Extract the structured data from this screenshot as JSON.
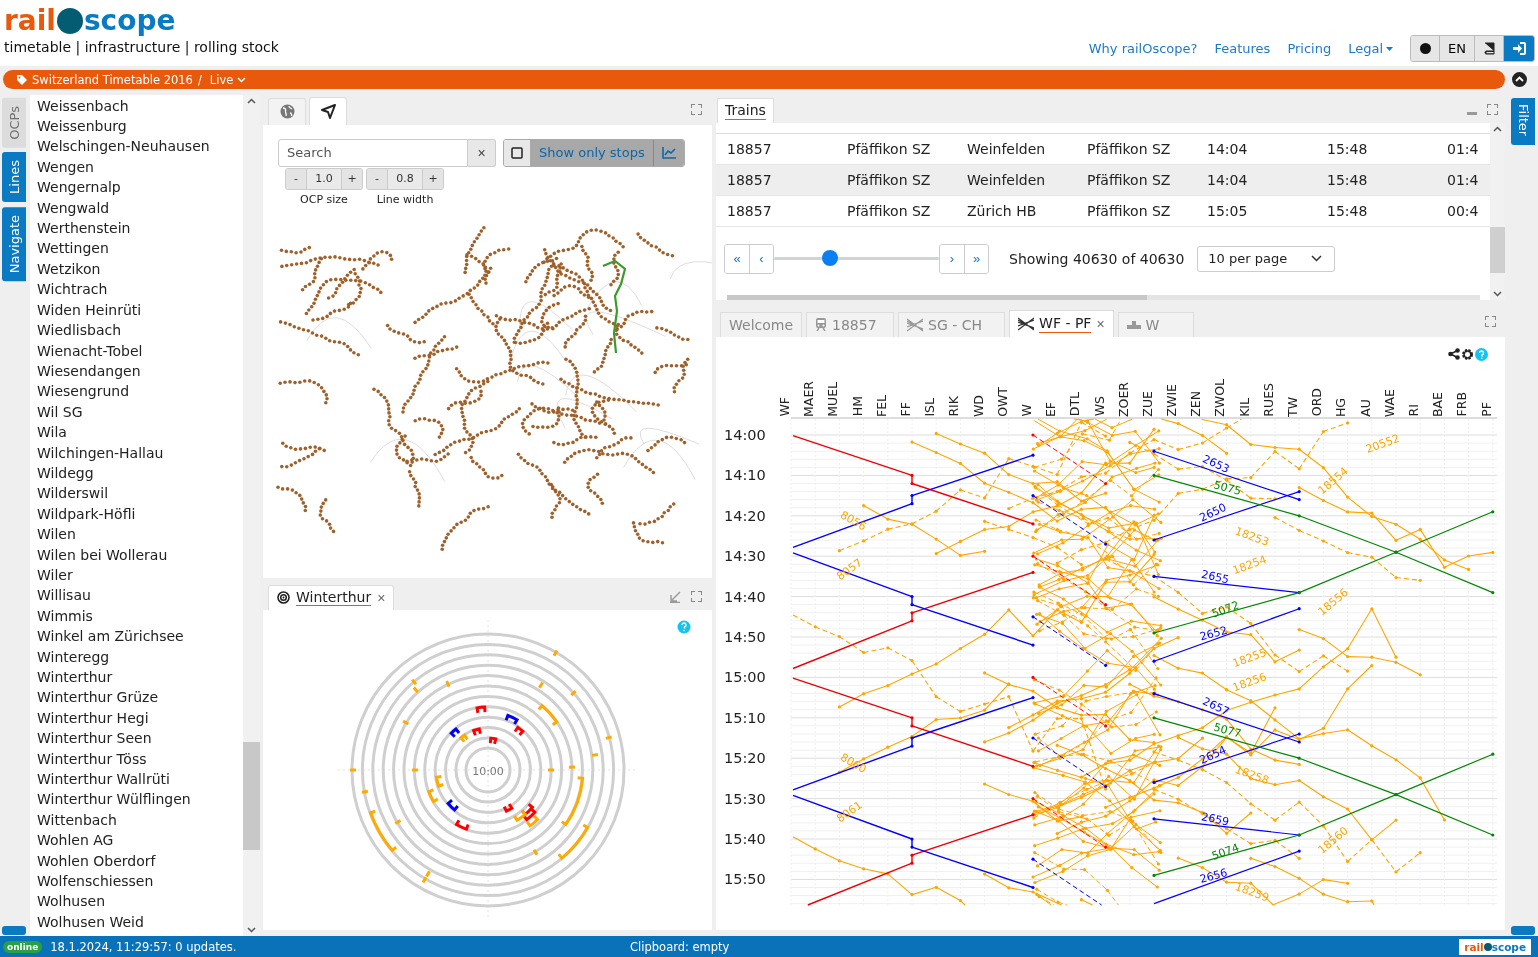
{
  "logo": {
    "part_1": "rail",
    "part_2": "scope"
  },
  "tagline": "timetable | infrastructure | rolling stock",
  "nav": [
    {
      "label": "Why railOscope?",
      "dropdown": false
    },
    {
      "label": "Features",
      "dropdown": false
    },
    {
      "label": "Pricing",
      "dropdown": false
    },
    {
      "label": "Legal",
      "dropdown": true
    }
  ],
  "toolbar": {
    "language": "EN"
  },
  "context_bar": {
    "timetable": "Switzerland Timetable 2016",
    "separator": "/",
    "mode": "Live"
  },
  "side_tabs": [
    {
      "label": "OCPs",
      "active": false
    },
    {
      "label": "Lines",
      "active": true
    },
    {
      "label": "Navigate",
      "active": true
    }
  ],
  "ocp_list": [
    "Weissenbach",
    "Weissenburg",
    "Welschingen-Neuhausen",
    "Wengen",
    "Wengernalp",
    "Wengwald",
    "Werthenstein",
    "Wettingen",
    "Wetzikon",
    "Wichtrach",
    "Widen Heinrüti",
    "Wiedlisbach",
    "Wienacht-Tobel",
    "Wiesendangen",
    "Wiesengrund",
    "Wil SG",
    "Wila",
    "Wilchingen-Hallau",
    "Wildegg",
    "Wilderswil",
    "Wildpark-Höfli",
    "Wilen",
    "Wilen bei Wollerau",
    "Wiler",
    "Willisau",
    "Wimmis",
    "Winkel am Zürichsee",
    "Winteregg",
    "Winterthur",
    "Winterthur Grüze",
    "Winterthur Hegi",
    "Winterthur Seen",
    "Winterthur Töss",
    "Winterthur Wallrüti",
    "Winterthur Wülflingen",
    "Wittenbach",
    "Wohlen AG",
    "Wohlen Oberdorf",
    "Wolfenschiessen",
    "Wolhusen",
    "Wolhusen Weid"
  ],
  "map_panel": {
    "tabs": [
      {
        "kind": "globe",
        "selected": false
      },
      {
        "kind": "network",
        "selected": true
      }
    ],
    "search": {
      "placeholder": "Search",
      "clear": "×"
    },
    "stops_toggle": {
      "label": "Show only stops",
      "checked": false
    },
    "ocp_size": {
      "minus": "-",
      "value": "1.0",
      "plus": "+",
      "label": "OCP size"
    },
    "line_width": {
      "minus": "-",
      "value": "0.8",
      "plus": "+",
      "label": "Line width"
    }
  },
  "station_panel": {
    "tab": {
      "label": "Winterthur",
      "close": "×"
    },
    "clock": "10:00"
  },
  "trains_panel": {
    "tab": "Trains",
    "rows": [
      {
        "cells": [
          "18857",
          "Pfäffikon SZ",
          "Weinfelden",
          "Pfäffikon SZ",
          "14:04",
          "15:48",
          "01:4"
        ]
      },
      {
        "cells": [
          "18857",
          "Pfäffikon SZ",
          "Weinfelden",
          "Pfäffikon SZ",
          "14:04",
          "15:48",
          "01:4"
        ]
      },
      {
        "cells": [
          "18857",
          "Pfäffikon SZ",
          "Zürich HB",
          "Pfäffikon SZ",
          "15:05",
          "15:48",
          "00:4"
        ]
      }
    ],
    "pager": {
      "first": "«",
      "prev": "‹",
      "level": 0.34,
      "next": "›",
      "last": "»",
      "status": "Showing 40630 of 40630",
      "per_page": "10 per page"
    }
  },
  "right_tabs": [
    {
      "label": "Filter"
    }
  ],
  "graph_panel": {
    "tabs": [
      {
        "label": "Welcome",
        "kind": "text",
        "selected": false
      },
      {
        "label": "18857",
        "kind": "train",
        "selected": false
      },
      {
        "label": "SG - CH",
        "kind": "graph",
        "selected": false
      },
      {
        "label": "WF - PF",
        "kind": "graph",
        "selected": true,
        "close": "×"
      },
      {
        "label": "W",
        "kind": "station",
        "selected": false
      }
    ],
    "stations": [
      "WF",
      "MAER",
      "MUEL",
      "HM",
      "FEL",
      "FF",
      "ISL",
      "RIK",
      "WD",
      "OWT",
      "W",
      "EF",
      "DTL",
      "WS",
      "ZOER",
      "ZUE",
      "ZWIE",
      "ZEN",
      "ZWOL",
      "KIL",
      "RUES",
      "TW",
      "ORD",
      "HG",
      "AU",
      "WAE",
      "RI",
      "BAE",
      "FRB",
      "PF"
    ],
    "times": [
      "14:00",
      "14:10",
      "14:20",
      "14:30",
      "14:40",
      "14:50",
      "15:00",
      "15:10",
      "15:20",
      "15:30",
      "15:40",
      "15:50"
    ],
    "train_labels": [
      "2653",
      "2650",
      "2655",
      "2652",
      "2657",
      "2654",
      "2659",
      "2656",
      "5075",
      "5072",
      "5077",
      "5074",
      "8056",
      "8057",
      "8060",
      "8061",
      "18554",
      "18556",
      "18560",
      "18253",
      "18254",
      "18255",
      "18256",
      "18258",
      "18259",
      "20552"
    ]
  },
  "status_bar": {
    "connection": "online",
    "message": "18.1.2024, 11:29:57: 0 updates.",
    "clipboard": "Clipboard: empty",
    "logo": {
      "part_1": "rail",
      "part_2": "scope"
    }
  }
}
